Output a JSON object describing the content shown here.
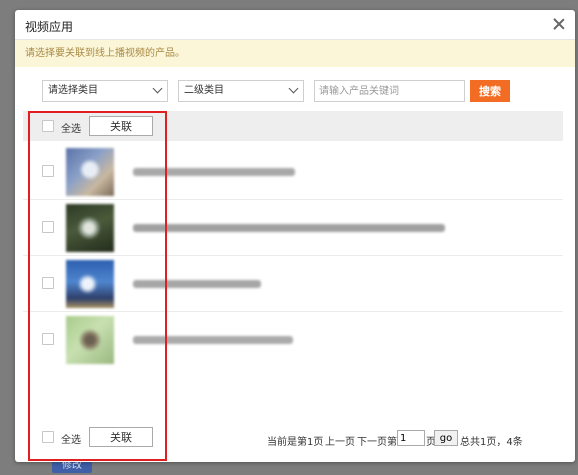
{
  "dialog": {
    "title": "视频应用",
    "notice": "请选择要关联到线上播视频的产品。"
  },
  "filters": {
    "category1": "请选择类目",
    "category2": "二级类目",
    "keyword_placeholder": "请输入产品关键词",
    "search_label": "搜索"
  },
  "header": {
    "select_all_label": "全选",
    "associate_label": "关联"
  },
  "footer": {
    "select_all_label": "全选",
    "associate_label": "关联"
  },
  "pagination": {
    "current_text": "当前是第1页",
    "prev_label": "上一页",
    "next_label": "下一页",
    "goto_prefix": "第",
    "page_value": "1",
    "goto_suffix": "页",
    "go_label": "go",
    "summary": "总共1页，4条"
  },
  "background_button_label": "修改",
  "colors": {
    "accent": "#f26c24",
    "highlight_border": "#e02020",
    "notice_bg": "#fbf6d8",
    "notice_text": "#a98a45"
  },
  "icons": {
    "close": "close-icon",
    "dropdown": "chevron-down-icon"
  }
}
